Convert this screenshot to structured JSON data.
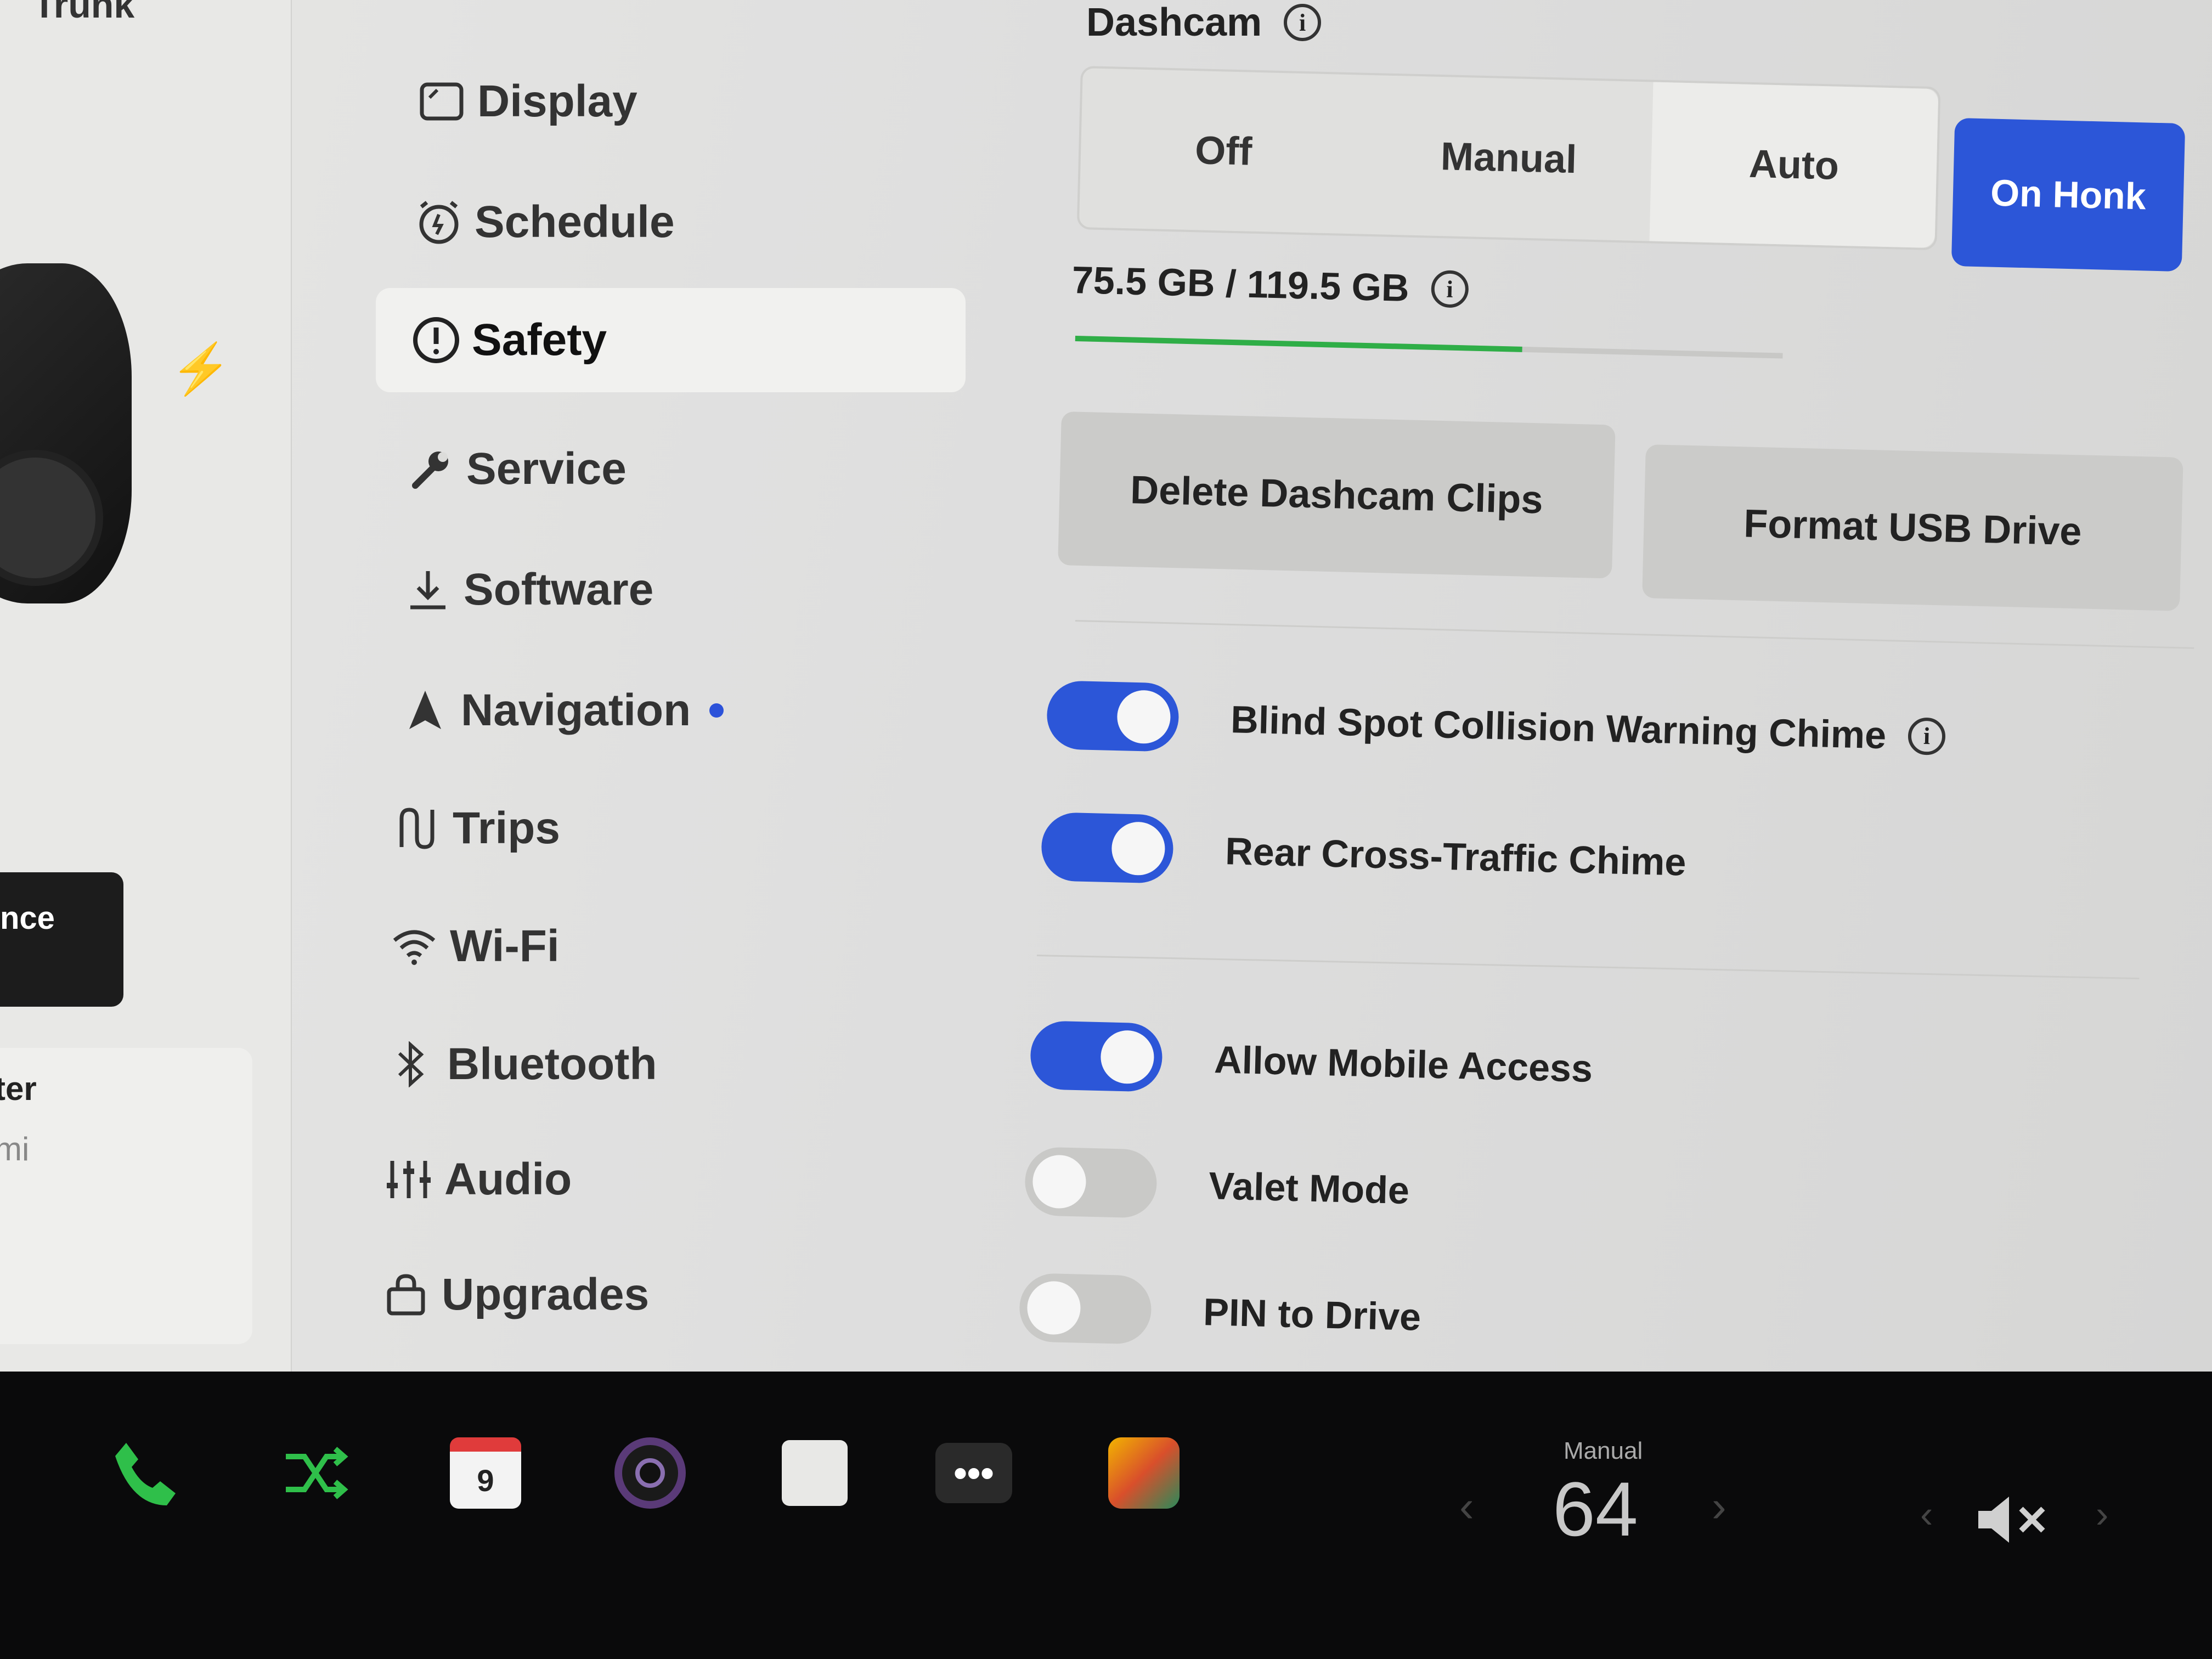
{
  "car": {
    "trunk_label": "Trunk",
    "range_button_label": "nce",
    "card_line1": "ter",
    "card_line2": "mi"
  },
  "menu": {
    "items": [
      {
        "label": "Display",
        "icon": "display-icon"
      },
      {
        "label": "Schedule",
        "icon": "schedule-icon"
      },
      {
        "label": "Safety",
        "icon": "safety-icon",
        "active": true
      },
      {
        "label": "Service",
        "icon": "wrench-icon"
      },
      {
        "label": "Software",
        "icon": "download-icon"
      },
      {
        "label": "Navigation",
        "icon": "navigation-icon",
        "badge": true
      },
      {
        "label": "Trips",
        "icon": "trips-icon"
      },
      {
        "label": "Wi-Fi",
        "icon": "wifi-icon"
      },
      {
        "label": "Bluetooth",
        "icon": "bluetooth-icon"
      },
      {
        "label": "Audio",
        "icon": "audio-icon"
      },
      {
        "label": "Upgrades",
        "icon": "upgrades-icon"
      }
    ]
  },
  "dashcam": {
    "title": "Dashcam",
    "options": [
      "Off",
      "Manual",
      "Auto"
    ],
    "selected": "Auto",
    "on_honk_label": "On Honk",
    "storage_text": "75.5 GB / 119.5 GB",
    "storage_used_fraction": 0.632,
    "delete_label": "Delete Dashcam Clips",
    "format_label": "Format USB Drive"
  },
  "toggles": {
    "blind_spot": {
      "label": "Blind Spot Collision Warning Chime",
      "on": true
    },
    "rear_cross": {
      "label": "Rear Cross-Traffic Chime",
      "on": true
    },
    "mobile_access": {
      "label": "Allow Mobile Access",
      "on": true
    },
    "valet": {
      "label": "Valet Mode",
      "on": false
    },
    "pin": {
      "label": "PIN to Drive",
      "on": false
    }
  },
  "taskbar": {
    "calendar_day": "9",
    "more_label": "•••",
    "temp_mode": "Manual",
    "temp_value": "64"
  },
  "colors": {
    "accent": "#2c56d8",
    "storage_bar": "#2fae47",
    "phone": "#2fbf4a"
  }
}
